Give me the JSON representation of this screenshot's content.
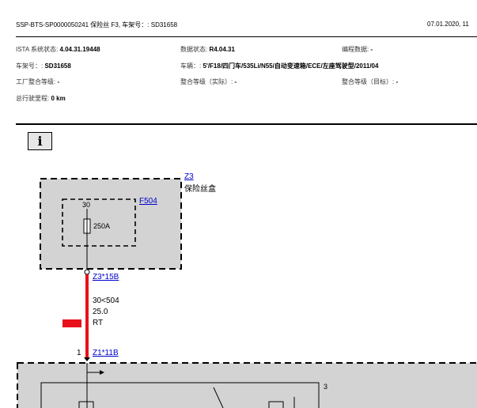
{
  "header": {
    "doc_title": "SSP-BTS-SP0000050241 保险丝 F3, 车架号：: SD31658",
    "date": "07.01.2020, 11"
  },
  "info": {
    "ista_label": "ISTA 系统状态:",
    "ista_value": "4.04.31.19448",
    "data_status_label": "数据状态:",
    "data_status_value": "R4.04.31",
    "programming_label": "编程数据:",
    "programming_value": "-",
    "vin_label": "车架号：:",
    "vin_value": "SD31658",
    "vehicle_label": "车辆：:",
    "vehicle_value": "5'/F18/四门车/535Li/N55/自动变速箱/ECE/左座驾驶型/2011/04",
    "factory_level_label": "工厂整合等级:",
    "factory_level_value": "-",
    "actual_level_label": "整合等级（实际）:",
    "actual_level_value": "-",
    "target_level_label": "整合等级（目标）:",
    "target_level_value": "-",
    "mileage_label": "总行驶里程:",
    "mileage_value": "0 km"
  },
  "info_button": {
    "icon": "info-icon",
    "glyph": "i"
  },
  "diagram": {
    "z3_link": "Z3",
    "z3_desc": "保险丝盒",
    "f504_link": "F504",
    "fuse_pin": "30",
    "fuse_rating": "250A",
    "connector_top_link": "Z3*15B",
    "wire_line1": "30<504",
    "wire_line2": "25.0",
    "wire_color_code": "RT",
    "wire_color": "#e8101a",
    "connector_bottom_pin": "1",
    "connector_bottom_link": "Z1*11B",
    "lower_box_label": "3"
  }
}
